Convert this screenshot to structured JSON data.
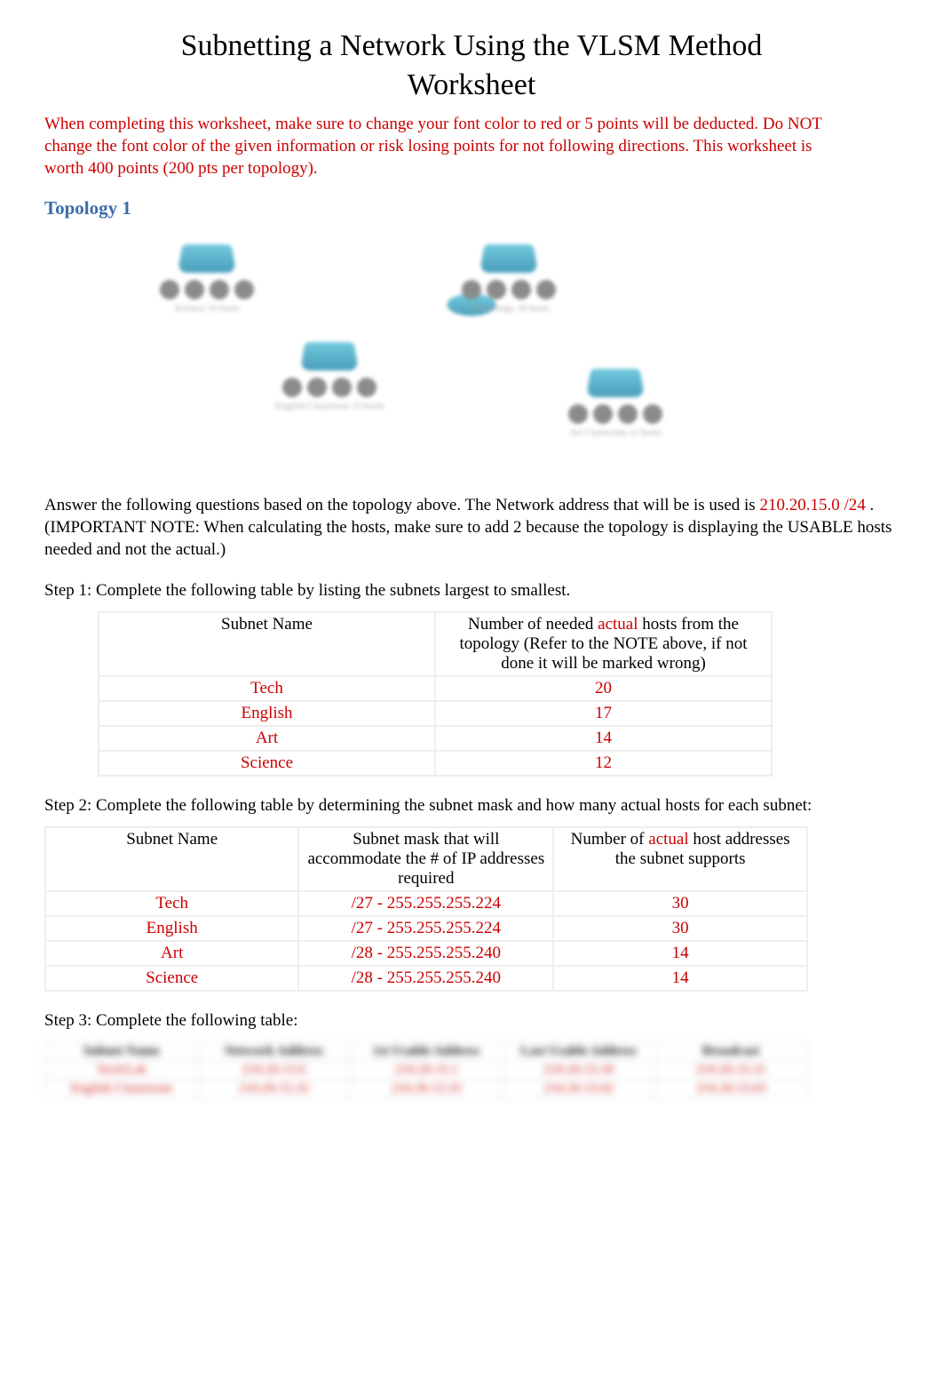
{
  "title": "Subnetting a Network Using the VLSM Method Worksheet",
  "warning": "When completing this worksheet, make sure to change your font color to red or 5 points will be deducted. Do NOT change the font color of the given information or risk losing points for not following directions. This worksheet is worth 400 points (200 pts per topology).",
  "topology_heading": "Topology 1",
  "instructions": {
    "pre_ip": "Answer the following questions based on the topology above. The Network address that will be is used is ",
    "ip": "210.20.15.0 /24",
    "post_ip_1": " . (IMPORTANT",
    "post_ip_2": " NOTE:",
    "post_ip_3": " When calculating the hosts, make sure to add 2 because the topology is displaying the USABLE",
    "post_ip_4": " hosts needed and not the actual.)"
  },
  "step1": {
    "label": "Step 1: Complete the following table by listing the subnets largest to smallest.",
    "header": {
      "col1": "Subnet Name",
      "col2_pre": "Number of needed ",
      "col2_red": "actual",
      "col2_post": " hosts from the topology (Refer to the NOTE above, if not done it will be marked wrong)"
    },
    "rows": [
      {
        "name": "Tech",
        "hosts": "20"
      },
      {
        "name": "English",
        "hosts": "17"
      },
      {
        "name": "Art",
        "hosts": "14"
      },
      {
        "name": "Science",
        "hosts": "12"
      }
    ]
  },
  "step2": {
    "label": "Step 2: Complete the following table by determining the subnet mask and how many actual hosts for   each subnet:",
    "header": {
      "col1": "Subnet Name",
      "col2": "Subnet mask that will accommodate the # of IP addresses required",
      "col3_pre": "Number of ",
      "col3_red": "actual",
      "col3_post": " host addresses the subnet supports"
    },
    "rows": [
      {
        "name": "Tech",
        "mask": "/27 - 255.255.255.224",
        "hosts": "30"
      },
      {
        "name": "English",
        "mask": "/27 - 255.255.255.224",
        "hosts": "30"
      },
      {
        "name": "Art",
        "mask": "/28 - 255.255.255.240",
        "hosts": "14"
      },
      {
        "name": "Science",
        "mask": "/28 - 255.255.255.240",
        "hosts": "14"
      }
    ]
  },
  "step3": {
    "label": "Step 3: Complete the following table:",
    "header": {
      "col1": "Subnet Name",
      "col2": "Network Address",
      "col3": "1st Usable Address",
      "col4": "Last Usable Address",
      "col5": "Broadcast"
    },
    "rows": [
      {
        "name": "Tech/Lab",
        "net": "210.20.15.0",
        "first": "210.20.15.1",
        "last": "210.20.15.30",
        "bcast": "210.20.15.31"
      },
      {
        "name": "English Classroom",
        "net": "210.20.15.32",
        "first": "210.20.15.33",
        "last": "210.20.15.62",
        "bcast": "210.20.15.63"
      }
    ]
  },
  "diagram_labels": {
    "g1": "Science\n10 hosts",
    "g2": "English Classroom\n15 hosts",
    "g3": "Technology\n18 hosts",
    "g4": "Art Classroom\n12 hosts"
  }
}
